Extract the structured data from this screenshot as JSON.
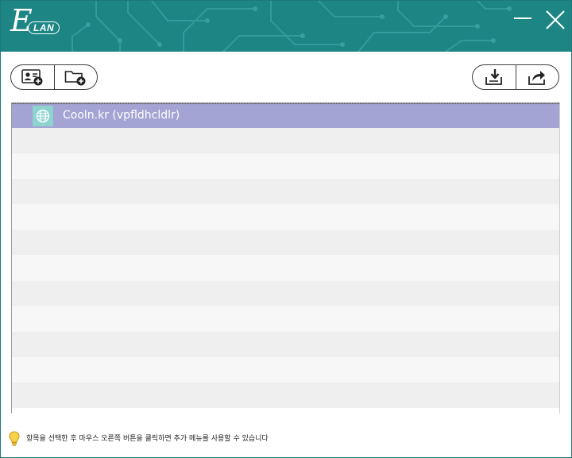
{
  "app": {
    "logo_text": "LAN",
    "logo_letter": "E"
  },
  "window_controls": {
    "minimize": "minimize",
    "close": "close"
  },
  "toolbar": {
    "left_buttons": [
      {
        "name": "add-contact",
        "icon": "contact-card-add-icon"
      },
      {
        "name": "add-folder",
        "icon": "folder-add-icon"
      }
    ],
    "right_buttons": [
      {
        "name": "import",
        "icon": "import-tray-icon"
      },
      {
        "name": "export",
        "icon": "export-share-icon"
      }
    ]
  },
  "list": {
    "items": [
      {
        "label": "Cooln.kr (vpfldhcldlr)",
        "icon": "globe-icon",
        "selected": true
      }
    ],
    "empty_rows": 11
  },
  "status": {
    "hint": "항목을 선택한 후 마우스 오른쪽 버튼을 클릭하면 추가 메뉴를 사용할 수 있습니다",
    "icon": "lightbulb-icon"
  },
  "colors": {
    "titlebar": "#1e8585",
    "selected_row": "#a3a3d4",
    "globe_bg": "#8fd3d0"
  }
}
